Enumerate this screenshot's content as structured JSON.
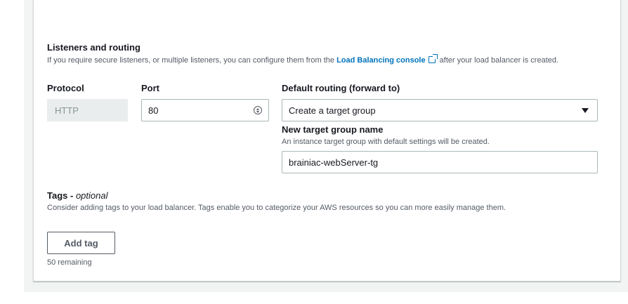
{
  "listeners": {
    "title": "Listeners and routing",
    "desc_before": "If you require secure listeners, or multiple listeners, you can configure them from the ",
    "console_link": "Load Balancing console",
    "desc_after": " after your load balancer is created.",
    "protocol_label": "Protocol",
    "protocol_value": "HTTP",
    "port_label": "Port",
    "port_value": "80",
    "routing_label": "Default routing (forward to)",
    "routing_value": "Create a target group",
    "new_tg_label": "New target group name",
    "new_tg_desc": "An instance target group with default settings will be created.",
    "new_tg_value": "brainiac-webServer-tg"
  },
  "tags": {
    "title": "Tags - ",
    "title_optional": "optional",
    "desc": "Consider adding tags to your load balancer. Tags enable you to categorize your AWS resources so you can more easily manage them.",
    "add_button": "Add tag",
    "remaining": "50 remaining"
  },
  "colors": {
    "link": "#0073bb",
    "text": "#16191f",
    "secondary_text": "#545b64",
    "disabled_bg": "#eaeded",
    "page_bg": "#f2f3f3"
  },
  "icons": {
    "external_link": "external-link-icon",
    "stepper": "stepper-icon",
    "dropdown": "caret-down-icon"
  }
}
